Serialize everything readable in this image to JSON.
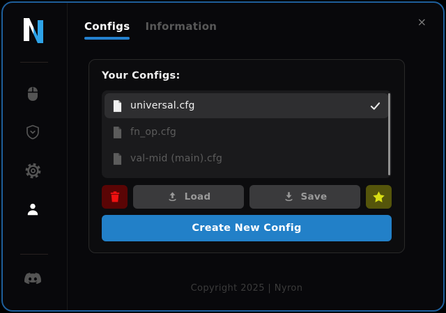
{
  "app": {
    "name": "Nyron",
    "logo_letter": "N",
    "close_label": "×"
  },
  "tabs": [
    {
      "label": "Configs",
      "active": true
    },
    {
      "label": "Information",
      "active": false
    }
  ],
  "sidebar_icons": [
    "mouse-icon",
    "shield-check-icon",
    "gear-icon",
    "user-icon",
    "discord-icon"
  ],
  "configs_panel": {
    "title": "Your Configs:",
    "items": [
      {
        "name": "universal.cfg",
        "selected": true
      },
      {
        "name": "fn_op.cfg",
        "selected": false
      },
      {
        "name": "val-mid (main).cfg",
        "selected": false
      }
    ],
    "actions": {
      "delete_icon": "trash-icon",
      "load": "Load",
      "save": "Save",
      "favorite_icon": "star-icon",
      "create": "Create New Config"
    }
  },
  "footer": {
    "copyright": "Copyright 2025 | Nyron"
  },
  "colors": {
    "accent_blue": "#2280c8",
    "tab_underline": "#2481cf",
    "window_border": "#1e5f9c",
    "danger_red": "#f01111",
    "danger_bg": "#5a0505",
    "star_yellow": "#d8de14",
    "star_bg": "#55550b",
    "logo_blue": "#2ea3e8"
  }
}
